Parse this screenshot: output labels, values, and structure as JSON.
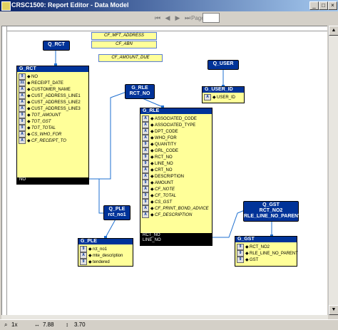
{
  "window": {
    "title": "CRSC1500: Report Editor - Data Model"
  },
  "toolbar": {
    "page_label": "Page:"
  },
  "formulas": {
    "f1": "CF_MFT_ADDRESS",
    "f2": "CF_ABN",
    "f3": "CF_AMOUNT_DUE"
  },
  "queries": {
    "q_rct": "Q_RCT",
    "q_user": "Q_USER",
    "q_rle": [
      "G_RLE",
      "RCT_NO"
    ],
    "q_ple": [
      "Q_PLE",
      "rct_no1"
    ],
    "q_gst": [
      "Q_GST",
      "RCT_NO2",
      "RLE_LINE_NO_PARENT"
    ]
  },
  "groups": {
    "g_rct": {
      "title": "G_RCT",
      "rows": [
        {
          "icon": "num",
          "text": "NO"
        },
        {
          "icon": "date",
          "text": "RECEIPT_DATE"
        },
        {
          "icon": "char",
          "text": "CUSTOMER_NAME"
        },
        {
          "icon": "char",
          "text": "CUST_ADDRESS_LINE1"
        },
        {
          "icon": "char",
          "text": "CUST_ADDRESS_LINE2"
        },
        {
          "icon": "char",
          "text": "CUST_ADDRESS_LINE3"
        },
        {
          "icon": "num",
          "text": "TOT_AMOUNT"
        },
        {
          "icon": "num",
          "text": "TOT_GST"
        },
        {
          "icon": "num",
          "text": "TOT_TOTAL"
        },
        {
          "icon": "char",
          "text": "CS_WHO_FOR"
        },
        {
          "icon": "char",
          "text": "CF_RECEIPT_TO"
        }
      ],
      "footer": [
        "NO"
      ]
    },
    "g_user_id": {
      "title": "G_USER_ID",
      "rows": [
        {
          "icon": "char",
          "text": "USER_ID"
        }
      ]
    },
    "g_rle": {
      "title": "G_RLE",
      "rows": [
        {
          "icon": "char",
          "text": "ASSOCIATED_CODE"
        },
        {
          "icon": "char",
          "text": "ASSOCIATED_TYPE"
        },
        {
          "icon": "char",
          "text": "DPT_CODE"
        },
        {
          "icon": "char",
          "text": "WHO_FOR"
        },
        {
          "icon": "num",
          "text": "QUANTITY"
        },
        {
          "icon": "char",
          "text": "GRL_CODE"
        },
        {
          "icon": "num",
          "text": "RCT_NO"
        },
        {
          "icon": "num",
          "text": "LINE_NO"
        },
        {
          "icon": "char",
          "text": "CRT_NO"
        },
        {
          "icon": "char",
          "text": "DESCRIPTION"
        },
        {
          "icon": "num",
          "text": "AMOUNT"
        },
        {
          "icon": "char",
          "text": "CF_NOTE"
        },
        {
          "icon": "num",
          "text": "CF_TOTAL"
        },
        {
          "icon": "num",
          "text": "CS_GST"
        },
        {
          "icon": "char",
          "text": "CF_PRINT_BOND_ADVICE"
        },
        {
          "icon": "char",
          "text": "CF_DESCRIPTION"
        }
      ],
      "footer": [
        "RCT_NO",
        "LINE_NO"
      ]
    },
    "g_ple": {
      "title": "G_PLE",
      "rows": [
        {
          "icon": "num",
          "text": "rct_no1"
        },
        {
          "icon": "char",
          "text": "mte_description"
        },
        {
          "icon": "num",
          "text": "tendered"
        }
      ]
    },
    "g_gst": {
      "title": "G_GST",
      "rows": [
        {
          "icon": "num",
          "text": "RCT_NO2"
        },
        {
          "icon": "num",
          "text": "RLE_LINE_NO_PARENT"
        },
        {
          "icon": "num",
          "text": "GST"
        }
      ]
    }
  },
  "status": {
    "zoom": "1x",
    "x": "7.88",
    "y": "3.70"
  }
}
